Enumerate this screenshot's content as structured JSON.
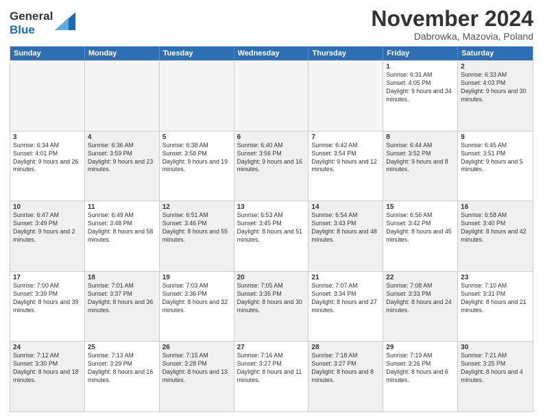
{
  "logo": {
    "line1": "General",
    "line2": "Blue"
  },
  "title": "November 2024",
  "location": "Dabrowka, Mazovia, Poland",
  "header_days": [
    "Sunday",
    "Monday",
    "Tuesday",
    "Wednesday",
    "Thursday",
    "Friday",
    "Saturday"
  ],
  "weeks": [
    [
      {
        "day": "",
        "info": "",
        "shaded": true
      },
      {
        "day": "",
        "info": "",
        "shaded": true
      },
      {
        "day": "",
        "info": "",
        "shaded": true
      },
      {
        "day": "",
        "info": "",
        "shaded": true
      },
      {
        "day": "",
        "info": "",
        "shaded": true
      },
      {
        "day": "1",
        "info": "Sunrise: 6:31 AM\nSunset: 4:05 PM\nDaylight: 9 hours and 34 minutes.",
        "shaded": false
      },
      {
        "day": "2",
        "info": "Sunrise: 6:33 AM\nSunset: 4:03 PM\nDaylight: 9 hours and 30 minutes.",
        "shaded": true
      }
    ],
    [
      {
        "day": "3",
        "info": "Sunrise: 6:34 AM\nSunset: 4:01 PM\nDaylight: 9 hours and 26 minutes.",
        "shaded": false
      },
      {
        "day": "4",
        "info": "Sunrise: 6:36 AM\nSunset: 3:59 PM\nDaylight: 9 hours and 23 minutes.",
        "shaded": true
      },
      {
        "day": "5",
        "info": "Sunrise: 6:38 AM\nSunset: 3:58 PM\nDaylight: 9 hours and 19 minutes.",
        "shaded": false
      },
      {
        "day": "6",
        "info": "Sunrise: 6:40 AM\nSunset: 3:56 PM\nDaylight: 9 hours and 16 minutes.",
        "shaded": true
      },
      {
        "day": "7",
        "info": "Sunrise: 6:42 AM\nSunset: 3:54 PM\nDaylight: 9 hours and 12 minutes.",
        "shaded": false
      },
      {
        "day": "8",
        "info": "Sunrise: 6:44 AM\nSunset: 3:52 PM\nDaylight: 9 hours and 8 minutes.",
        "shaded": true
      },
      {
        "day": "9",
        "info": "Sunrise: 6:45 AM\nSunset: 3:51 PM\nDaylight: 9 hours and 5 minutes.",
        "shaded": false
      }
    ],
    [
      {
        "day": "10",
        "info": "Sunrise: 6:47 AM\nSunset: 3:49 PM\nDaylight: 9 hours and 2 minutes.",
        "shaded": true
      },
      {
        "day": "11",
        "info": "Sunrise: 6:49 AM\nSunset: 3:48 PM\nDaylight: 8 hours and 58 minutes.",
        "shaded": false
      },
      {
        "day": "12",
        "info": "Sunrise: 6:51 AM\nSunset: 3:46 PM\nDaylight: 8 hours and 55 minutes.",
        "shaded": true
      },
      {
        "day": "13",
        "info": "Sunrise: 6:53 AM\nSunset: 3:45 PM\nDaylight: 8 hours and 51 minutes.",
        "shaded": false
      },
      {
        "day": "14",
        "info": "Sunrise: 6:54 AM\nSunset: 3:43 PM\nDaylight: 8 hours and 48 minutes.",
        "shaded": true
      },
      {
        "day": "15",
        "info": "Sunrise: 6:56 AM\nSunset: 3:42 PM\nDaylight: 8 hours and 45 minutes.",
        "shaded": false
      },
      {
        "day": "16",
        "info": "Sunrise: 6:58 AM\nSunset: 3:40 PM\nDaylight: 8 hours and 42 minutes.",
        "shaded": true
      }
    ],
    [
      {
        "day": "17",
        "info": "Sunrise: 7:00 AM\nSunset: 3:39 PM\nDaylight: 8 hours and 39 minutes.",
        "shaded": false
      },
      {
        "day": "18",
        "info": "Sunrise: 7:01 AM\nSunset: 3:37 PM\nDaylight: 8 hours and 36 minutes.",
        "shaded": true
      },
      {
        "day": "19",
        "info": "Sunrise: 7:03 AM\nSunset: 3:36 PM\nDaylight: 8 hours and 32 minutes.",
        "shaded": false
      },
      {
        "day": "20",
        "info": "Sunrise: 7:05 AM\nSunset: 3:35 PM\nDaylight: 8 hours and 30 minutes.",
        "shaded": true
      },
      {
        "day": "21",
        "info": "Sunrise: 7:07 AM\nSunset: 3:34 PM\nDaylight: 8 hours and 27 minutes.",
        "shaded": false
      },
      {
        "day": "22",
        "info": "Sunrise: 7:08 AM\nSunset: 3:33 PM\nDaylight: 8 hours and 24 minutes.",
        "shaded": true
      },
      {
        "day": "23",
        "info": "Sunrise: 7:10 AM\nSunset: 3:31 PM\nDaylight: 8 hours and 21 minutes.",
        "shaded": false
      }
    ],
    [
      {
        "day": "24",
        "info": "Sunrise: 7:12 AM\nSunset: 3:30 PM\nDaylight: 8 hours and 18 minutes.",
        "shaded": true
      },
      {
        "day": "25",
        "info": "Sunrise: 7:13 AM\nSunset: 3:29 PM\nDaylight: 8 hours and 16 minutes.",
        "shaded": false
      },
      {
        "day": "26",
        "info": "Sunrise: 7:15 AM\nSunset: 3:28 PM\nDaylight: 8 hours and 13 minutes.",
        "shaded": true
      },
      {
        "day": "27",
        "info": "Sunrise: 7:16 AM\nSunset: 3:27 PM\nDaylight: 8 hours and 11 minutes.",
        "shaded": false
      },
      {
        "day": "28",
        "info": "Sunrise: 7:18 AM\nSunset: 3:27 PM\nDaylight: 8 hours and 8 minutes.",
        "shaded": true
      },
      {
        "day": "29",
        "info": "Sunrise: 7:19 AM\nSunset: 3:26 PM\nDaylight: 8 hours and 6 minutes.",
        "shaded": false
      },
      {
        "day": "30",
        "info": "Sunrise: 7:21 AM\nSunset: 3:25 PM\nDaylight: 8 hours and 4 minutes.",
        "shaded": true
      }
    ]
  ]
}
